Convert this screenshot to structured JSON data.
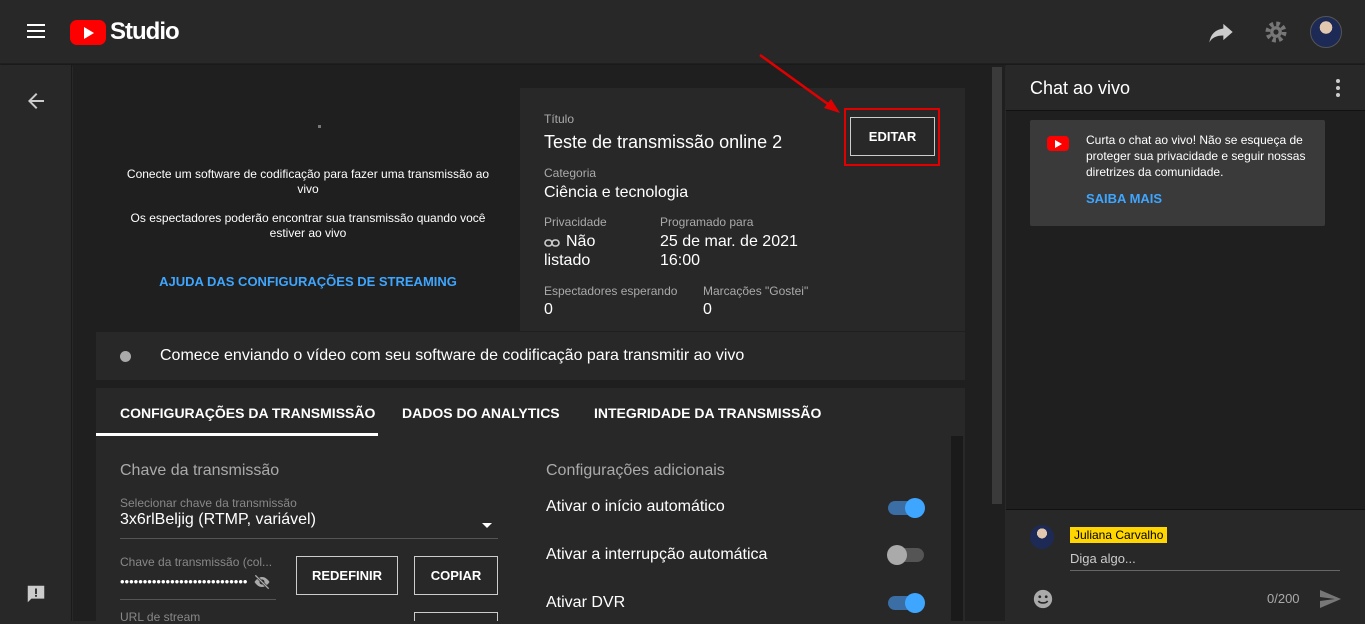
{
  "header": {
    "logo_text": "Studio"
  },
  "preview": {
    "message_1": "Conecte um software de codificação para fazer uma transmissão ao vivo",
    "message_2": "Os espectadores poderão encontrar sua transmissão quando você estiver ao vivo",
    "help_link": "AJUDA DAS CONFIGURAÇÕES DE STREAMING"
  },
  "details": {
    "title_label": "Título",
    "title_value": "Teste de transmissão online 2",
    "edit_button": "EDITAR",
    "category_label": "Categoria",
    "category_value": "Ciência e tecnologia",
    "privacy_label": "Privacidade",
    "privacy_value_line1": "Não",
    "privacy_value_line2": "listado",
    "scheduled_label": "Programado para",
    "scheduled_value_line1": "25 de mar. de 2021",
    "scheduled_value_line2": "16:00",
    "viewers_label": "Espectadores esperando",
    "viewers_value": "0",
    "likes_label": "Marcações \"Gostei\"",
    "likes_value": "0"
  },
  "status": {
    "text": "Comece enviando o vídeo com seu software de codificação para transmitir ao vivo"
  },
  "tabs": [
    {
      "label": "CONFIGURAÇÕES DA TRANSMISSÃO",
      "selected": true
    },
    {
      "label": "DADOS DO ANALYTICS",
      "selected": false
    },
    {
      "label": "INTEGRIDADE DA TRANSMISSÃO",
      "selected": false
    }
  ],
  "config": {
    "stream_key_title": "Chave da transmissão",
    "select_key_label": "Selecionar chave da transmissão",
    "select_key_value": "3x6rlBeljig (RTMP, variável)",
    "key_field_label": "Chave da transmissão (col...",
    "key_field_value": "••••••••••••••••••••••••••••",
    "reset_button": "REDEFINIR",
    "copy_button": "COPIAR",
    "stream_url_label": "URL de stream",
    "additional_title": "Configurações adicionais",
    "toggles": [
      {
        "label": "Ativar o início automático",
        "on": true
      },
      {
        "label": "Ativar a interrupção automática",
        "on": false
      },
      {
        "label": "Ativar DVR",
        "on": true
      }
    ]
  },
  "chat": {
    "title": "Chat ao vivo",
    "card_text": "Curta o chat ao vivo! Não se esqueça de proteger sua privacidade e seguir nossas diretrizes da comunidade.",
    "card_link": "SAIBA MAIS",
    "user_name": "Juliana Carvalho",
    "input_placeholder": "Diga algo...",
    "counter": "0/200"
  },
  "colors": {
    "accent_blue": "#3ea6ff",
    "brand_red": "#ff0000",
    "highlight_red": "#e00000",
    "name_badge": "#ffd600"
  }
}
